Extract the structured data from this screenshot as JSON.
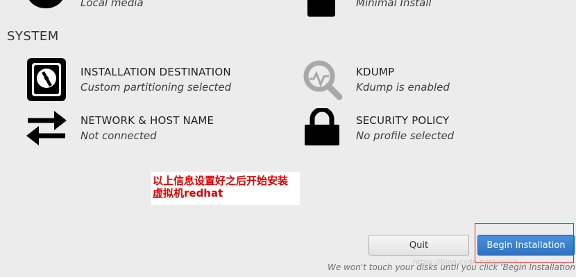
{
  "top_row": {
    "left_status": "Local media",
    "right_status": "Minimal Install",
    "left_icon": "disc-icon",
    "right_icon": "package-icon"
  },
  "system": {
    "heading": "SYSTEM",
    "spokes": [
      {
        "title": "INSTALLATION DESTINATION",
        "status": "Custom partitioning selected",
        "icon": "hard-disk-icon"
      },
      {
        "title": "KDUMP",
        "status": "Kdump is enabled",
        "icon": "magnifier-icon"
      },
      {
        "title": "NETWORK & HOST NAME",
        "status": "Not connected",
        "icon": "network-arrows-icon"
      },
      {
        "title": "SECURITY POLICY",
        "status": "No profile selected",
        "icon": "padlock-icon"
      }
    ]
  },
  "annotation": {
    "line1": "以上信息设置好之后开始安装",
    "line2": "虚拟机redhat",
    "color": "#e00000"
  },
  "buttons": {
    "quit": "Quit",
    "begin": "Begin Installation"
  },
  "footer": {
    "note": "We won't touch your disks until you click 'Begin Installation'.",
    "watermark": "https://blog.csdn.net/weixin_..."
  },
  "colors": {
    "background": "#ececec",
    "accent": "#3a80d0",
    "highlight": "#e02020"
  }
}
